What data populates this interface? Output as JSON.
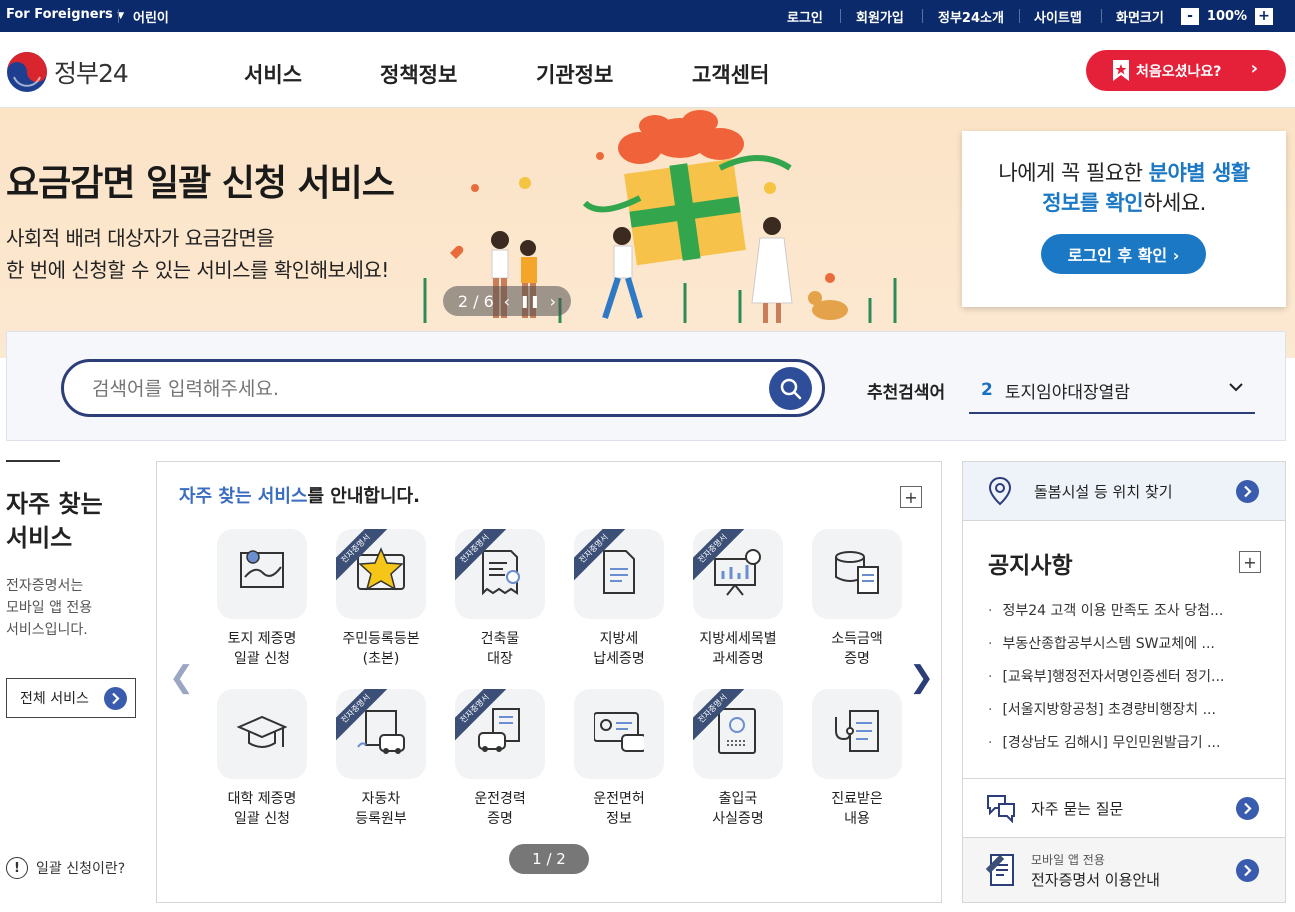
{
  "topbar": {
    "foreigners": "For Foreigners",
    "kids": "어린이",
    "login": "로그인",
    "signup": "회원가입",
    "about": "정부24소개",
    "sitemap": "사이트맵",
    "zoom_label": "화면크기",
    "zoom_value": "100%",
    "zoom_minus": "-",
    "zoom_plus": "+"
  },
  "header": {
    "logo_text": "정부24",
    "nav": [
      "서비스",
      "정책정보",
      "기관정보",
      "고객센터"
    ],
    "first_visit": "처음오셨나요?"
  },
  "hero": {
    "title": "요금감면 일괄 신청 서비스",
    "desc_line1": "사회적 배려 대상자가 요금감면을",
    "desc_line2": "한 번에 신청할 수 있는 서비스를 확인해보세요!",
    "pager": "2 / 6"
  },
  "lifebox": {
    "msg_a": "나에게 꼭 필요한 ",
    "msg_hl1": "분야별 생활",
    "msg_hl2": "정보를 확인",
    "msg_b": "하세요.",
    "button": "로그인 후 확인 ›"
  },
  "search": {
    "placeholder": "검색어를 입력해주세요.",
    "reco_label": "추천검색어",
    "reco_num": "2",
    "reco_text": "토지임야대장열람"
  },
  "frequent": {
    "heading_line1": "자주 찾는",
    "heading_line2": "서비스",
    "desc": "전자증명서는\n모바일 앱 전용\n서비스입니다.",
    "all_services": "전체 서비스",
    "batch_info": "일괄 신청이란?",
    "panel_title_hl": "자주 찾는 서비스",
    "panel_title_rest": "를 안내합니다.",
    "ribbon": "전자증명서",
    "page": "1 / 2",
    "items": [
      {
        "label": "토지 제증명\n일괄 신청",
        "icon": "land-map-icon",
        "ribbon": false
      },
      {
        "label": "주민등록등본\n(초본)",
        "icon": "resident-card-star-icon",
        "ribbon": true
      },
      {
        "label": "건축물\n대장",
        "icon": "building-doc-icon",
        "ribbon": true
      },
      {
        "label": "지방세\n납세증명",
        "icon": "tax-doc-icon",
        "ribbon": true
      },
      {
        "label": "지방세세목별\n과세증명",
        "icon": "chart-board-icon",
        "ribbon": true
      },
      {
        "label": "소득금액\n증명",
        "icon": "coins-doc-icon",
        "ribbon": false
      },
      {
        "label": "대학 제증명\n일괄 신청",
        "icon": "graduation-cap-icon",
        "ribbon": false
      },
      {
        "label": "자동차\n등록원부",
        "icon": "car-register-icon",
        "ribbon": true
      },
      {
        "label": "운전경력\n증명",
        "icon": "driving-record-icon",
        "ribbon": true
      },
      {
        "label": "운전면허\n정보",
        "icon": "license-card-icon",
        "ribbon": false
      },
      {
        "label": "출입국\n사실증명",
        "icon": "passport-icon",
        "ribbon": true
      },
      {
        "label": "진료받은\n내용",
        "icon": "medical-record-icon",
        "ribbon": false
      }
    ]
  },
  "right": {
    "care_facility": "돌봄시설 등 위치 찾기",
    "notice_title": "공지사항",
    "notices": [
      "정부24 고객 이용 만족도 조사 당첨...",
      "부동산종합공부시스템 SW교체에 ...",
      "[교육부]행정전자서명인증센터 정기...",
      "[서울지방항공청] 초경량비행장치 ...",
      "[경상남도 김해시] 무인민원발급기 ..."
    ],
    "faq": "자주 묻는 질문",
    "mobile_small": "모바일 앱 전용",
    "mobile_main": "전자증명서 이용안내"
  },
  "colors": {
    "navy": "#0b2a6b",
    "accent_red": "#e5213a",
    "accent_blue": "#1b78c4"
  }
}
